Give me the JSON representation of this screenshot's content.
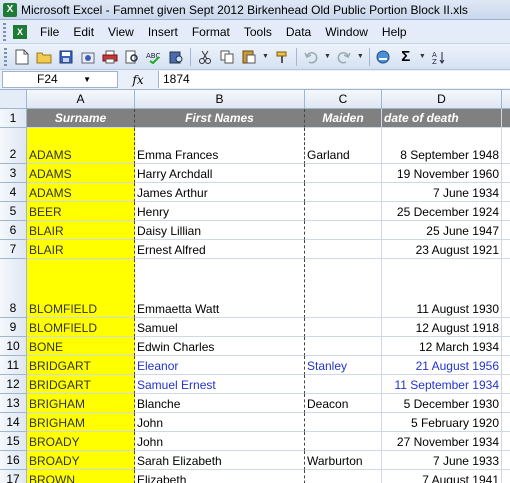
{
  "window": {
    "title": "Microsoft Excel - Famnet given Sept 2012 Birkenhead Old Public Portion Block II.xls",
    "app_icon": "excel-icon"
  },
  "menu": [
    "File",
    "Edit",
    "View",
    "Insert",
    "Format",
    "Tools",
    "Data",
    "Window",
    "Help"
  ],
  "toolbar": {
    "icons": [
      "new-icon",
      "open-icon",
      "save-icon",
      "permission-icon",
      "print-icon",
      "print-preview-icon",
      "spelling-icon",
      "research-icon",
      "cut-icon",
      "copy-icon",
      "paste-icon",
      "format-painter-icon",
      "undo-icon",
      "redo-icon",
      "hyperlink-icon",
      "autosum-icon",
      "sort-icon"
    ],
    "autosum_glyph": "Σ"
  },
  "formula_bar": {
    "name_box": "F24",
    "fx_label": "fx",
    "value": "1874"
  },
  "columns": [
    "A",
    "B",
    "C",
    "D"
  ],
  "header_row": {
    "row_number": "1",
    "surname": "Surname",
    "first_names": "First Names",
    "maiden": "Maiden",
    "date_of_death": "date of death"
  },
  "rows": [
    {
      "num": "2",
      "surname": "ADAMS",
      "first": "Emma Frances",
      "maiden": "Garland",
      "date": "8 September 1948",
      "tall": true,
      "blue": false
    },
    {
      "num": "3",
      "surname": "ADAMS",
      "first": "Harry Archdall",
      "maiden": "",
      "date": "19 November 1960",
      "tall": false,
      "blue": false
    },
    {
      "num": "4",
      "surname": "ADAMS",
      "first": "James Arthur",
      "maiden": "",
      "date": "7 June 1934",
      "tall": false,
      "blue": false
    },
    {
      "num": "5",
      "surname": "BEER",
      "first": "Henry",
      "maiden": "",
      "date": "25 December 1924",
      "tall": false,
      "blue": false
    },
    {
      "num": "6",
      "surname": "BLAIR",
      "first": "Daisy Lillian",
      "maiden": "",
      "date": "25 June 1947",
      "tall": false,
      "blue": false
    },
    {
      "num": "7",
      "surname": "BLAIR",
      "first": "Ernest Alfred",
      "maiden": "",
      "date": "23 August 1921",
      "tall": false,
      "blue": false
    },
    {
      "num": "8",
      "surname": "BLOMFIELD",
      "first": "Emmaetta Watt",
      "maiden": "",
      "date": "11 August 1930",
      "tall": "xl",
      "blue": false
    },
    {
      "num": "9",
      "surname": "BLOMFIELD",
      "first": "Samuel",
      "maiden": "",
      "date": "12 August 1918",
      "tall": false,
      "blue": false
    },
    {
      "num": "10",
      "surname": "BONE",
      "first": "Edwin Charles",
      "maiden": "",
      "date": "12 March 1934",
      "tall": false,
      "blue": false
    },
    {
      "num": "11",
      "surname": "BRIDGART",
      "first": "Eleanor",
      "maiden": "Stanley",
      "date": "21 August 1956",
      "tall": false,
      "blue": true
    },
    {
      "num": "12",
      "surname": "BRIDGART",
      "first": "Samuel Ernest",
      "maiden": "",
      "date": "11 September 1934",
      "tall": false,
      "blue": true
    },
    {
      "num": "13",
      "surname": "BRIGHAM",
      "first": "Blanche",
      "maiden": "Deacon",
      "date": "5 December 1930",
      "tall": false,
      "blue": false
    },
    {
      "num": "14",
      "surname": "BRIGHAM",
      "first": "John",
      "maiden": "",
      "date": "5 February 1920",
      "tall": false,
      "blue": false
    },
    {
      "num": "15",
      "surname": "BROADY",
      "first": "John",
      "maiden": "",
      "date": "27 November 1934",
      "tall": false,
      "blue": false
    },
    {
      "num": "16",
      "surname": "BROADY",
      "first": "Sarah Elizabeth",
      "maiden": "Warburton",
      "date": "7 June 1933",
      "tall": false,
      "blue": false
    },
    {
      "num": "17",
      "surname": "BROWN",
      "first": "Elizabeth",
      "maiden": "",
      "date": "7 August 1941",
      "tall": false,
      "blue": false
    }
  ],
  "colors": {
    "highlight_yellow": "#ffff00",
    "header_gray": "#808080",
    "blue_text": "#2233cc"
  }
}
